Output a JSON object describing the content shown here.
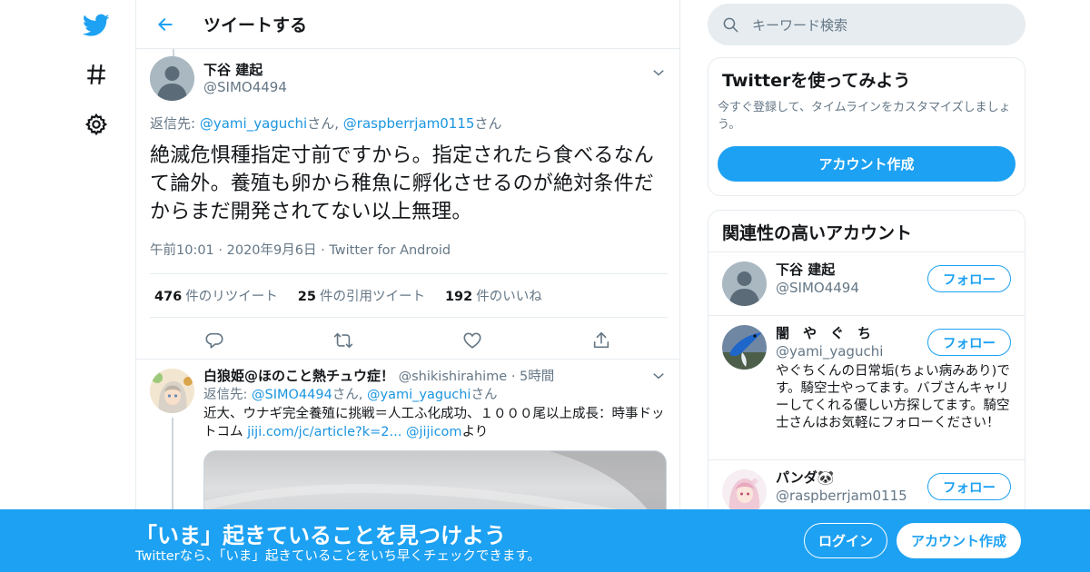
{
  "nav": {
    "icons": [
      "twitter-bird-icon",
      "hashtag-icon",
      "settings-gear-icon"
    ]
  },
  "header": {
    "title": "ツイートする"
  },
  "tweet": {
    "author_name": "下谷 建起",
    "author_handle": "@SIMO4494",
    "reply_prefix": "返信先:",
    "reply_user1": "@yami_yaguchi",
    "reply_san1": "さん,",
    "reply_user2": "@raspberrjam0115",
    "reply_san2": "さん",
    "text": "絶滅危惧種指定寸前ですから。指定されたら食べるなんて論外。養殖も卵から稚魚に孵化させるのが絶対条件だからまだ開発されてない以上無理。",
    "time": "午前10:01",
    "date": "2020年9月6日",
    "source": "Twitter for Android",
    "sep": "·",
    "retweets_count": "476",
    "retweets_label": "件のリツイート",
    "quotes_count": "25",
    "quotes_label": "件の引用ツイート",
    "likes_count": "192",
    "likes_label": "件のいいね"
  },
  "reply": {
    "author_name": "白狼姫@ほのこと熱チュウ症！",
    "author_handle": "@shikishirahime",
    "sep": "·",
    "time": "5時間",
    "reply_prefix": "返信先:",
    "reply_user1": "@SIMO4494",
    "reply_san1": "さん,",
    "reply_user2": "@yami_yaguchi",
    "reply_san2": "さん",
    "text": "近大、ウナギ完全養殖に挑戦＝人工ふ化成功、１０００尾以上成長：時事ドットコム",
    "link": "jiji.com/jc/article?k=2...",
    "mention": "@jijicom",
    "suffix": "より"
  },
  "search": {
    "placeholder": "キーワード検索"
  },
  "signup_card": {
    "title": "Twitterを使ってみよう",
    "subtitle": "今すぐ登録して、タイムラインをカスタマイズしましょう。",
    "button": "アカウント作成"
  },
  "related": {
    "title": "関連性の高いアカウント",
    "follow_label": "フォロー",
    "accounts": [
      {
        "name": "下谷 建起",
        "handle": "@SIMO4494",
        "bio": ""
      },
      {
        "name": "闇　や　ぐ　ち",
        "handle": "@yami_yaguchi",
        "bio": "やぐちくんの日常垢(ちょい病みあり)です。騎空士やってます。バブさんキャリーしてくれる優しい方探してます。騎空士さんはお気軽にフォローください！"
      },
      {
        "name": "パンダ🐼",
        "handle": "@raspberrjam0115",
        "bio": ""
      }
    ]
  },
  "banner": {
    "title": "「いま」起きていることを見つけよう",
    "subtitle": "Twitterなら、「いま」起きていることをいち早くチェックできます。",
    "login": "ログイン",
    "signup": "アカウント作成"
  },
  "colors": {
    "brand_blue": "#1da1f2",
    "link_blue": "#1b95e0",
    "muted": "#657786",
    "border": "#e6ecf0"
  }
}
